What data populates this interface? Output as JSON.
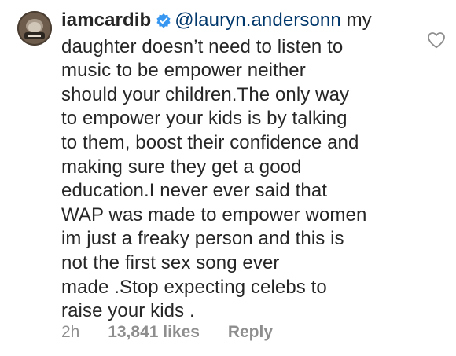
{
  "comment": {
    "username": "iamcardib",
    "mention": "@lauryn.andersonn",
    "text_lines": [
      " my",
      "daughter doesn’t need to listen to",
      "music to be empower neither",
      "should your children.The only way",
      "to empower your kids is by talking",
      "to them, boost their confidence and",
      "making sure they get a good",
      "education.I never ever said that",
      "WAP was made to empower women",
      "im just a freaky person and this is",
      "not the first sex song ever",
      "made .Stop expecting celebs to",
      "raise your kids ."
    ],
    "time": "2h",
    "likes": "13,841 likes",
    "reply_label": "Reply"
  },
  "icons": {
    "verified": "verified-badge-icon",
    "like": "heart-outline-icon",
    "avatar": "profile-avatar"
  },
  "colors": {
    "text": "#262626",
    "mention": "#00376b",
    "meta": "#8e8e8e",
    "verified": "#3897f0",
    "heart": "#8e8e8e"
  }
}
